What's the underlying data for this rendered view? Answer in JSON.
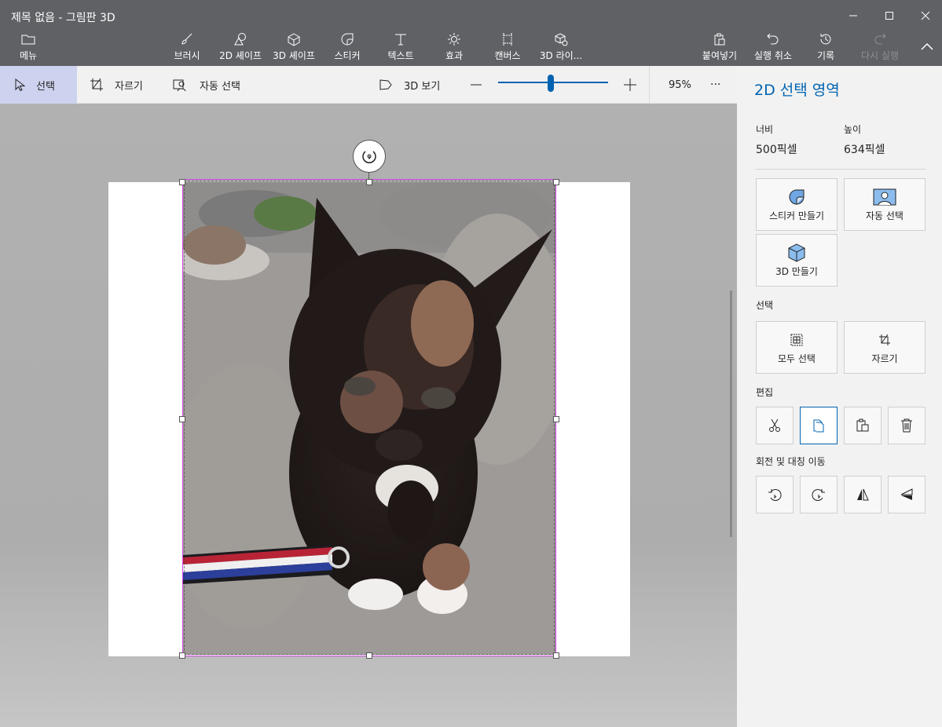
{
  "window": {
    "title": "제목 없음 - 그림판 3D"
  },
  "toolbar": {
    "menu": "메뉴",
    "brush": "브러시",
    "shapes2d": "2D 셰이프",
    "shapes3d": "3D 셰이프",
    "stickers": "스티커",
    "text": "텍스트",
    "effects": "효과",
    "canvas": "캔버스",
    "library3d": "3D 라이...",
    "paste": "붙여넣기",
    "undo": "실행 취소",
    "history": "기록",
    "redo": "다시 실행"
  },
  "subbar": {
    "select": "선택",
    "crop": "자르기",
    "magic_select": "자동 선택",
    "view3d": "3D 보기",
    "zoom_label": "95%",
    "zoom_level": 0.48,
    "more": "···"
  },
  "panel": {
    "title": "2D 선택 영역",
    "width_label": "너비",
    "height_label": "높이",
    "width_value": "500픽셀",
    "height_value": "634픽셀",
    "make_sticker": "스티커 만들기",
    "magic_select": "자동 선택",
    "make_3d": "3D 만들기",
    "section_select": "선택",
    "select_all": "모두 선택",
    "crop": "자르기",
    "section_edit": "편집",
    "section_rotate": "회전 및 대칭 이동"
  },
  "colors": {
    "accent": "#0063b1",
    "titlebar": "#5f6165",
    "selection": "#cf42e6"
  }
}
